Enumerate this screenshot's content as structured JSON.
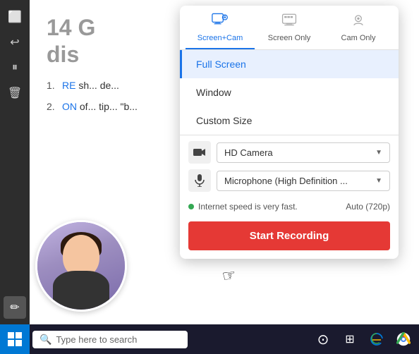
{
  "sidebar": {
    "icons": [
      "⬜",
      "↩",
      "⏸",
      "🗑",
      "✏"
    ]
  },
  "main": {
    "heading_part1": "14 G",
    "heading_part2": "dis",
    "list": [
      {
        "num": "1.",
        "link": "RE",
        "text": "sh... de..."
      },
      {
        "num": "2.",
        "link": "ON",
        "text": "of... tip... \"b..."
      }
    ]
  },
  "popup": {
    "tabs": [
      {
        "id": "screen-cam",
        "label": "Screen+Cam",
        "active": true
      },
      {
        "id": "screen-only",
        "label": "Screen Only",
        "active": false
      },
      {
        "id": "cam-only",
        "label": "Cam Only",
        "active": false
      }
    ],
    "screen_options": [
      {
        "id": "full-screen",
        "label": "Full Screen",
        "selected": true
      },
      {
        "id": "window",
        "label": "Window",
        "selected": false
      },
      {
        "id": "custom-size",
        "label": "Custom Size",
        "selected": false
      }
    ],
    "camera": {
      "label": "HD Camera",
      "arrow": "▼"
    },
    "microphone": {
      "label": "Microphone (High Definition ...",
      "arrow": "▼"
    },
    "status": {
      "speed_text": "Internet speed is very fast.",
      "quality": "Auto (720p)"
    },
    "start_button": "Start Recording"
  },
  "taskbar": {
    "search_placeholder": "Type here to search",
    "icons": [
      "⊙",
      "⊞",
      "🌐",
      "★"
    ]
  }
}
